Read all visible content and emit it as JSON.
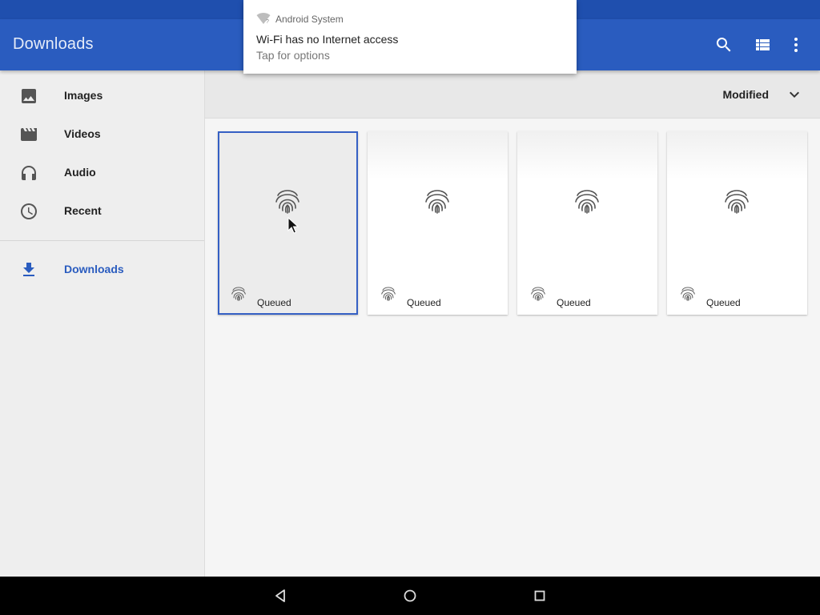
{
  "app": {
    "title": "Downloads"
  },
  "notification": {
    "app_name": "Android System",
    "title": "Wi-Fi has no Internet access",
    "text": "Tap for options"
  },
  "toolbar": {
    "search_icon": "search-icon",
    "view_icon": "list-view-icon",
    "more_icon": "more-vert-icon"
  },
  "sidebar": {
    "items": [
      {
        "label": "Images",
        "icon": "image-icon"
      },
      {
        "label": "Videos",
        "icon": "movie-icon"
      },
      {
        "label": "Audio",
        "icon": "headphones-icon"
      },
      {
        "label": "Recent",
        "icon": "clock-icon"
      },
      {
        "label": "Downloads",
        "icon": "download-icon",
        "active": true
      }
    ]
  },
  "sort": {
    "label": "Modified"
  },
  "files": [
    {
      "status": "Queued",
      "selected": true
    },
    {
      "status": "Queued"
    },
    {
      "status": "Queued"
    },
    {
      "status": "Queued"
    }
  ],
  "colors": {
    "primary": "#2a5cbf",
    "status_bar": "#1f4fae",
    "active_nav": "#2a5cbf"
  }
}
